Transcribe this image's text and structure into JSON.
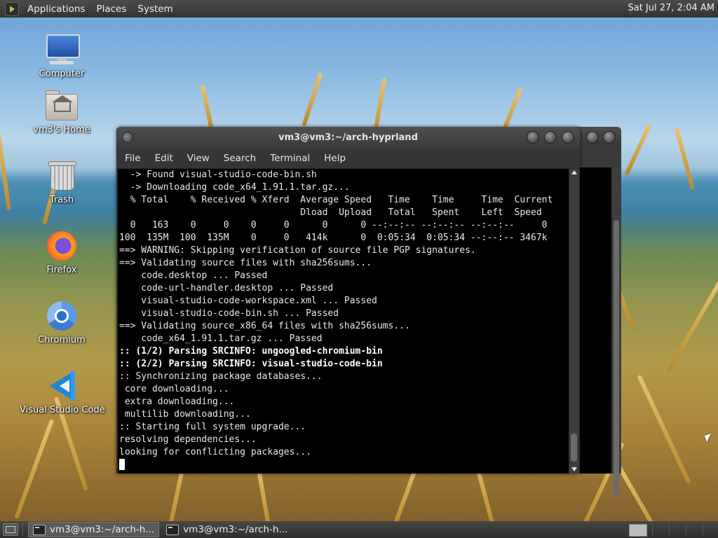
{
  "top_panel": {
    "menus": [
      "Applications",
      "Places",
      "System"
    ],
    "clock": "Sat Jul 27,  2:04 AM"
  },
  "desktop_icons": [
    {
      "label": "Computer",
      "icon": "computer-icon"
    },
    {
      "label": "vm3's Home",
      "icon": "home-folder-icon"
    },
    {
      "label": "Trash",
      "icon": "trash-icon"
    },
    {
      "label": "Firefox",
      "icon": "firefox-icon"
    },
    {
      "label": "Chromium",
      "icon": "chromium-icon"
    },
    {
      "label": "Visual Studio Code",
      "icon": "vscode-icon"
    }
  ],
  "terminal": {
    "title": "vm3@vm3:~/arch-hyprland",
    "menu": [
      "File",
      "Edit",
      "View",
      "Search",
      "Terminal",
      "Help"
    ],
    "lines": [
      {
        "text": "  -> Found visual-studio-code-bin.sh",
        "bold": false
      },
      {
        "text": "  -> Downloading code_x64_1.91.1.tar.gz...",
        "bold": false
      },
      {
        "text": "  % Total    % Received % Xferd  Average Speed   Time    Time     Time  Current",
        "bold": false
      },
      {
        "text": "                                 Dload  Upload   Total   Spent    Left  Speed",
        "bold": false
      },
      {
        "text": "  0   163    0     0    0     0      0      0 --:--:-- --:--:-- --:--:--     0",
        "bold": false
      },
      {
        "text": "100  135M  100  135M    0     0   414k      0  0:05:34  0:05:34 --:--:-- 3467k",
        "bold": false
      },
      {
        "text": "==> WARNING: Skipping verification of source file PGP signatures.",
        "bold": false
      },
      {
        "text": "==> Validating source files with sha256sums...",
        "bold": false
      },
      {
        "text": "    code.desktop ... Passed",
        "bold": false
      },
      {
        "text": "    code-url-handler.desktop ... Passed",
        "bold": false
      },
      {
        "text": "    visual-studio-code-workspace.xml ... Passed",
        "bold": false
      },
      {
        "text": "    visual-studio-code-bin.sh ... Passed",
        "bold": false
      },
      {
        "text": "==> Validating source_x86_64 files with sha256sums...",
        "bold": false
      },
      {
        "text": "    code_x64_1.91.1.tar.gz ... Passed",
        "bold": false
      },
      {
        "text": ":: (1/2) Parsing SRCINFO: ungoogled-chromium-bin",
        "bold": true
      },
      {
        "text": ":: (2/2) Parsing SRCINFO: visual-studio-code-bin",
        "bold": true
      },
      {
        "text": ":: Synchronizing package databases...",
        "bold": false
      },
      {
        "text": " core downloading...",
        "bold": false
      },
      {
        "text": " extra downloading...",
        "bold": false
      },
      {
        "text": " multilib downloading...",
        "bold": false
      },
      {
        "text": ":: Starting full system upgrade...",
        "bold": false
      },
      {
        "text": "resolving dependencies...",
        "bold": false
      },
      {
        "text": "looking for conflicting packages...",
        "bold": false
      }
    ]
  },
  "taskbar": {
    "tasks": [
      {
        "label": "vm3@vm3:~/arch-h...",
        "active": true
      },
      {
        "label": "vm3@vm3:~/arch-h...",
        "active": false
      }
    ]
  }
}
